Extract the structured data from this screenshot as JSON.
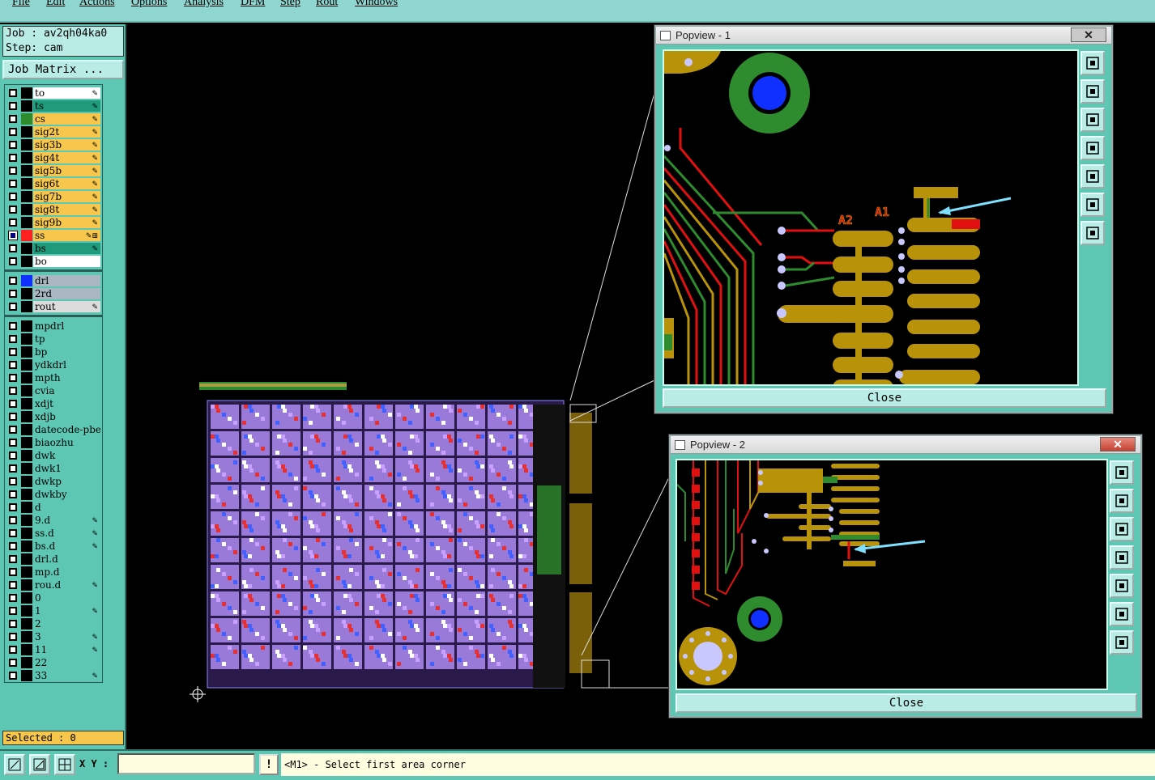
{
  "menu": [
    "File",
    "Edit",
    "Actions",
    "Options",
    "Analysis",
    "DFM",
    "Step",
    "Rout",
    "Windows"
  ],
  "job": {
    "job_line": "Job : av2qh04ka0",
    "step_line": "Step: cam"
  },
  "job_matrix_label": "Job Matrix ...",
  "layers": [
    {
      "name": "to",
      "bg": "#ffffff",
      "swatch": "#000000",
      "mark": "✎"
    },
    {
      "name": "ts",
      "bg": "#1f9a7a",
      "swatch": "#000000",
      "mark": "✎"
    },
    {
      "name": "cs",
      "bg": "#f6c64d",
      "swatch": "#2e8b2e",
      "mark": "✎"
    },
    {
      "name": "sig2t",
      "bg": "#f6c64d",
      "swatch": "#000000",
      "mark": "✎"
    },
    {
      "name": "sig3b",
      "bg": "#f6c64d",
      "swatch": "#000000",
      "mark": "✎"
    },
    {
      "name": "sig4t",
      "bg": "#f6c64d",
      "swatch": "#000000",
      "mark": "✎"
    },
    {
      "name": "sig5b",
      "bg": "#f6c64d",
      "swatch": "#000000",
      "mark": "✎"
    },
    {
      "name": "sig6t",
      "bg": "#f6c64d",
      "swatch": "#000000",
      "mark": "✎"
    },
    {
      "name": "sig7b",
      "bg": "#f6c64d",
      "swatch": "#000000",
      "mark": "✎"
    },
    {
      "name": "sig8t",
      "bg": "#f6c64d",
      "swatch": "#000000",
      "mark": "✎"
    },
    {
      "name": "sig9b",
      "bg": "#f6c64d",
      "swatch": "#000000",
      "mark": "✎"
    },
    {
      "name": "ss",
      "bg": "#f6c64d",
      "swatch": "#ff2020",
      "mark": "✎⊞",
      "checked": true
    },
    {
      "name": "bs",
      "bg": "#1f9a7a",
      "swatch": "#000000",
      "mark": "✎"
    },
    {
      "name": "bo",
      "bg": "#ffffff",
      "swatch": "#000000",
      "mark": ""
    },
    {
      "name": "drl",
      "bg": "#a9b8c0",
      "swatch": "#1030ff",
      "mark": "",
      "gap": true
    },
    {
      "name": "2rd",
      "bg": "#a9b8c0",
      "swatch": "#000000",
      "mark": ""
    },
    {
      "name": "rout",
      "bg": "#dcdcdc",
      "swatch": "#000000",
      "mark": "✎"
    },
    {
      "name": "mpdrl",
      "bg": "#5ec7b3",
      "swatch": "#000000",
      "mark": "",
      "gap": true
    },
    {
      "name": "tp",
      "bg": "#5ec7b3",
      "swatch": "#000000",
      "mark": ""
    },
    {
      "name": "bp",
      "bg": "#5ec7b3",
      "swatch": "#000000",
      "mark": ""
    },
    {
      "name": "ydkdrl",
      "bg": "#5ec7b3",
      "swatch": "#000000",
      "mark": ""
    },
    {
      "name": "mpth",
      "bg": "#5ec7b3",
      "swatch": "#000000",
      "mark": ""
    },
    {
      "name": "cvia",
      "bg": "#5ec7b3",
      "swatch": "#000000",
      "mark": ""
    },
    {
      "name": "xdjt",
      "bg": "#5ec7b3",
      "swatch": "#000000",
      "mark": ""
    },
    {
      "name": "xdjb",
      "bg": "#5ec7b3",
      "swatch": "#000000",
      "mark": ""
    },
    {
      "name": "datecode-pbe",
      "bg": "#5ec7b3",
      "swatch": "#000000",
      "mark": ""
    },
    {
      "name": "biaozhu",
      "bg": "#5ec7b3",
      "swatch": "#000000",
      "mark": ""
    },
    {
      "name": "dwk",
      "bg": "#5ec7b3",
      "swatch": "#000000",
      "mark": ""
    },
    {
      "name": "dwk1",
      "bg": "#5ec7b3",
      "swatch": "#000000",
      "mark": ""
    },
    {
      "name": "dwkp",
      "bg": "#5ec7b3",
      "swatch": "#000000",
      "mark": ""
    },
    {
      "name": "dwkby",
      "bg": "#5ec7b3",
      "swatch": "#000000",
      "mark": ""
    },
    {
      "name": "d",
      "bg": "#5ec7b3",
      "swatch": "#000000",
      "mark": ""
    },
    {
      "name": "9.d",
      "bg": "#5ec7b3",
      "swatch": "#000000",
      "mark": "✎"
    },
    {
      "name": "ss.d",
      "bg": "#5ec7b3",
      "swatch": "#000000",
      "mark": "✎"
    },
    {
      "name": "bs.d",
      "bg": "#5ec7b3",
      "swatch": "#000000",
      "mark": "✎"
    },
    {
      "name": "drl.d",
      "bg": "#5ec7b3",
      "swatch": "#000000",
      "mark": ""
    },
    {
      "name": "mp.d",
      "bg": "#5ec7b3",
      "swatch": "#000000",
      "mark": ""
    },
    {
      "name": "rou.d",
      "bg": "#5ec7b3",
      "swatch": "#000000",
      "mark": "✎"
    },
    {
      "name": "0",
      "bg": "#5ec7b3",
      "swatch": "#000000",
      "mark": ""
    },
    {
      "name": "1",
      "bg": "#5ec7b3",
      "swatch": "#000000",
      "mark": "✎"
    },
    {
      "name": "2",
      "bg": "#5ec7b3",
      "swatch": "#000000",
      "mark": ""
    },
    {
      "name": "3",
      "bg": "#5ec7b3",
      "swatch": "#000000",
      "mark": "✎"
    },
    {
      "name": "11",
      "bg": "#5ec7b3",
      "swatch": "#000000",
      "mark": "✎"
    },
    {
      "name": "22",
      "bg": "#5ec7b3",
      "swatch": "#000000",
      "mark": ""
    },
    {
      "name": "33",
      "bg": "#5ec7b3",
      "swatch": "#000000",
      "mark": "✎"
    }
  ],
  "selected_label": "Selected : 0",
  "popup1": {
    "title": "Popview - 1",
    "close_label": "Close",
    "close_x": "✕",
    "labels": [
      "A2",
      "A1"
    ]
  },
  "popup2": {
    "title": "Popview - 2",
    "close_label": "Close",
    "close_x": "✕"
  },
  "statusbar": {
    "xy_label": "X Y :",
    "xy_value": "",
    "warn_label": "!",
    "message": "<M1> - Select first area corner"
  },
  "colors": {
    "panel": "#5ec7b3",
    "copper": "#b8930a",
    "trace_red": "#e01010",
    "trace_green": "#2e8b2e",
    "via_blue": "#1030ff",
    "arrow": "#7fdfff"
  }
}
